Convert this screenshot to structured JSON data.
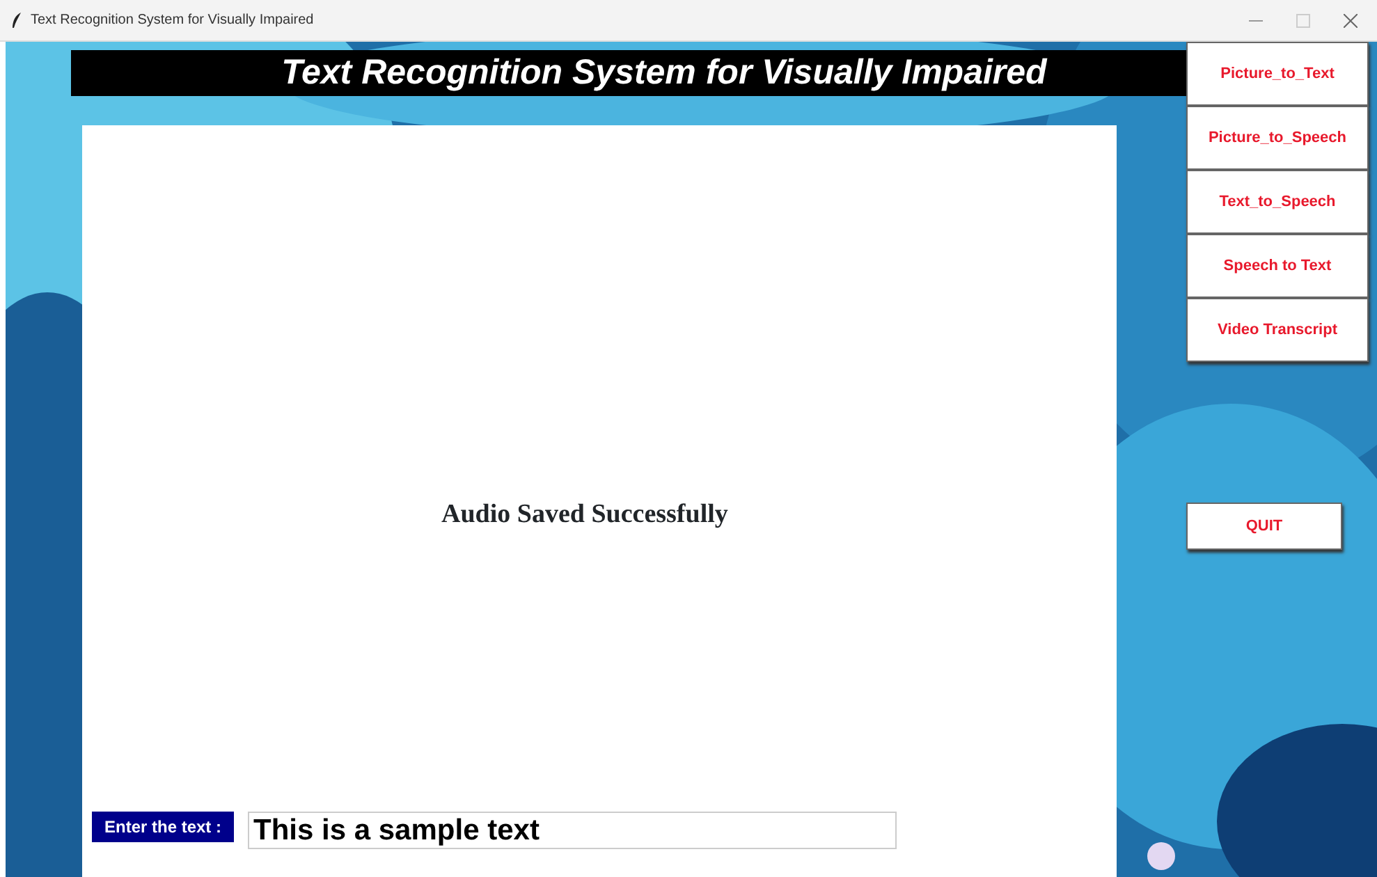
{
  "window": {
    "title": "Text Recognition System for Visually Impaired"
  },
  "banner": {
    "title": "Text Recognition System for Visually Impaired"
  },
  "output": {
    "message": "Audio Saved Successfully"
  },
  "input": {
    "label": "Enter the text :",
    "value": "This is a sample text"
  },
  "menu_buttons": [
    {
      "label": "Picture_to_Text"
    },
    {
      "label": "Picture_to_Speech"
    },
    {
      "label": "Text_to_Speech"
    },
    {
      "label": "Speech to Text"
    },
    {
      "label": "Video Transcript"
    }
  ],
  "quit_button": {
    "label": "QUIT"
  }
}
